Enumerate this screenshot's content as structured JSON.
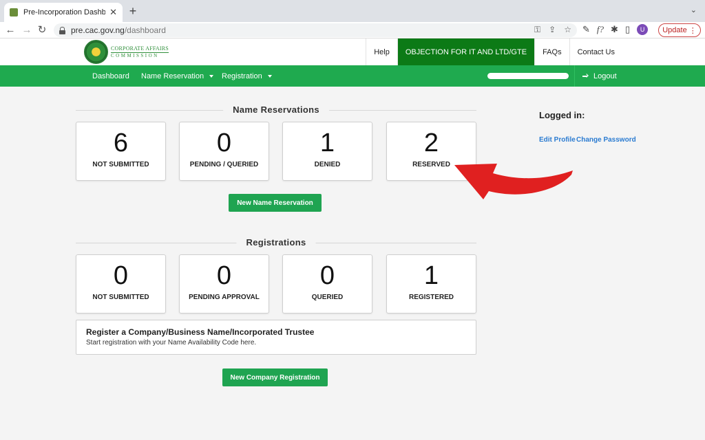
{
  "browser": {
    "tab_title": "Pre-Incorporation Dashboard",
    "tab_close": "✕",
    "new_tab": "+",
    "tab_list": "⌄",
    "url_domain": "pre.cac.gov.ng",
    "url_path": "/dashboard",
    "back": "←",
    "forward": "→",
    "reload": "↻",
    "omni_icons": [
      "⚿",
      "⇪",
      "☆"
    ],
    "ext_icons": [
      "✎",
      "f?",
      "✱",
      "▯"
    ],
    "avatar_letter": "U",
    "update_label": "Update",
    "update_menu": "⋮"
  },
  "site": {
    "logo_line1": "CORPORATE AFFAIRS",
    "logo_line2": "COMMISSION",
    "top_links": {
      "help": "Help",
      "objection": "OBJECTION FOR IT AND LTD/GTE",
      "faqs": "FAQs",
      "contact": "Contact Us"
    },
    "nav": {
      "dashboard": "Dashboard",
      "name_reservation": "Name Reservation",
      "registration": "Registration",
      "logout": "Logout"
    }
  },
  "name_reservations": {
    "title": "Name Reservations",
    "cards": [
      {
        "count": "6",
        "label": "NOT SUBMITTED"
      },
      {
        "count": "0",
        "label": "PENDING / QUERIED"
      },
      {
        "count": "1",
        "label": "DENIED"
      },
      {
        "count": "2",
        "label": "RESERVED"
      }
    ],
    "new_button": "New Name Reservation"
  },
  "registrations": {
    "title": "Registrations",
    "cards": [
      {
        "count": "0",
        "label": "NOT SUBMITTED"
      },
      {
        "count": "0",
        "label": "PENDING APPROVAL"
      },
      {
        "count": "0",
        "label": "QUERIED"
      },
      {
        "count": "1",
        "label": "REGISTERED"
      }
    ],
    "register_title": "Register a Company/Business Name/Incorporated Trustee",
    "register_sub": "Start registration with your Name Availability Code here.",
    "new_button": "New Company Registration"
  },
  "sidebar": {
    "logged_in": "Logged in:",
    "edit_profile": "Edit Profile",
    "change_password": "Change Password"
  },
  "colors": {
    "brand_green": "#1faa4f",
    "highlight_green": "#0c7a16",
    "arrow_red": "#e02020",
    "link_blue": "#2a7bd1"
  }
}
